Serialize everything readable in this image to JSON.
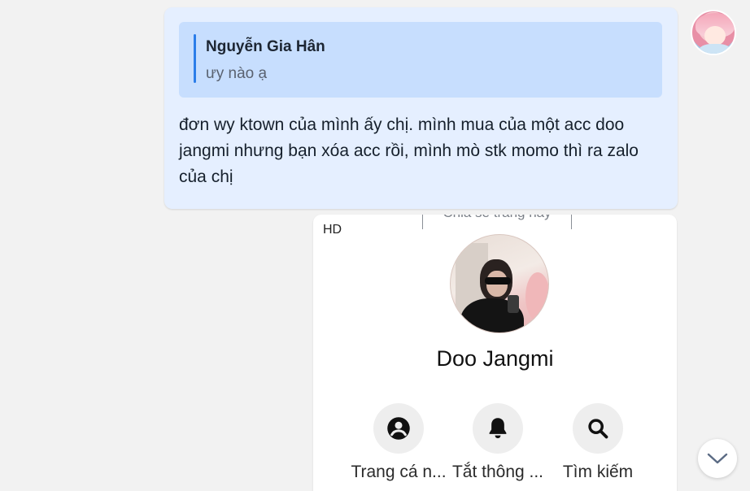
{
  "message": {
    "quote": {
      "author": "Nguyễn Gia Hân",
      "text": "ưy nào ạ"
    },
    "text": "đơn wy ktown của mình ấy chị. mình mua của một acc doo jangmi nhưng bạn xóa acc rồi, mình mò stk momo thì ra zalo của chị"
  },
  "preview": {
    "badge": "HD",
    "share_label": "Chia sẻ trang này",
    "profile_name": "Doo Jangmi",
    "actions": [
      {
        "label": "Trang cá n...",
        "icon": "profile-icon"
      },
      {
        "label": "Tắt thông ...",
        "icon": "bell-icon"
      },
      {
        "label": "Tìm kiếm",
        "icon": "search-icon"
      }
    ]
  },
  "colors": {
    "background": "#f2f2f2",
    "bubble": "#e5efff",
    "quote_bg": "#c7defe",
    "quote_bar": "#2b7de9"
  }
}
